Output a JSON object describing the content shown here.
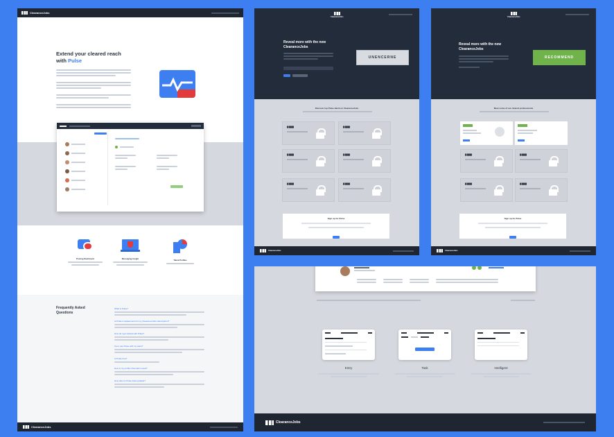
{
  "brand": {
    "name": "ClearanceJobs",
    "short": "ClearanceJobs"
  },
  "left_panel": {
    "hero_title_1": "Extend your cleared reach",
    "hero_title_2": "with ",
    "hero_title_accent": "Pulse",
    "features": [
      {
        "title": "Posting Dashboard",
        "icon": "chat-bubble-icon"
      },
      {
        "title": "Messaging Insight",
        "icon": "laptop-shield-icon"
      },
      {
        "title": "Talent Profiles",
        "icon": "pie-chart-icon"
      }
    ],
    "faq_title_1": "Frequently Asked",
    "faq_title_2": "Questions",
    "faq_items": [
      "What is Pulse?",
      "Is Pulse a replacement for my ClearanceJobs subscription?",
      "How do I get started with Pulse?",
      "Can I use Pulse with my team?",
      "Is Pulse free?",
      "How is my profile information used?",
      "How often is Pulse data updated?"
    ]
  },
  "top_middle": {
    "heading_1": "Reveal more with the new",
    "heading_2": "ClearanceJobs",
    "tag": "UNENCERNE",
    "section_title": "Discover top Pulse talent on ClearanceJobs",
    "signup_title": "Sign up for Pulse"
  },
  "top_right": {
    "heading_1": "Reveal more with the new",
    "heading_2": "ClearanceJobs",
    "tag": "RECOMMEND",
    "section_title": "Meet some of our cleared professionals",
    "signup_title": "Sign up for Pulse"
  },
  "bottom_panel": {
    "phones": [
      {
        "label": "Entry"
      },
      {
        "label": "Task"
      },
      {
        "label": "Intelligent"
      }
    ],
    "footer_brand": "ClearanceJobs"
  },
  "colors": {
    "accent": "#3d7ef0",
    "dark": "#232c3b",
    "green": "#6fb34a",
    "red": "#e23b3b"
  }
}
